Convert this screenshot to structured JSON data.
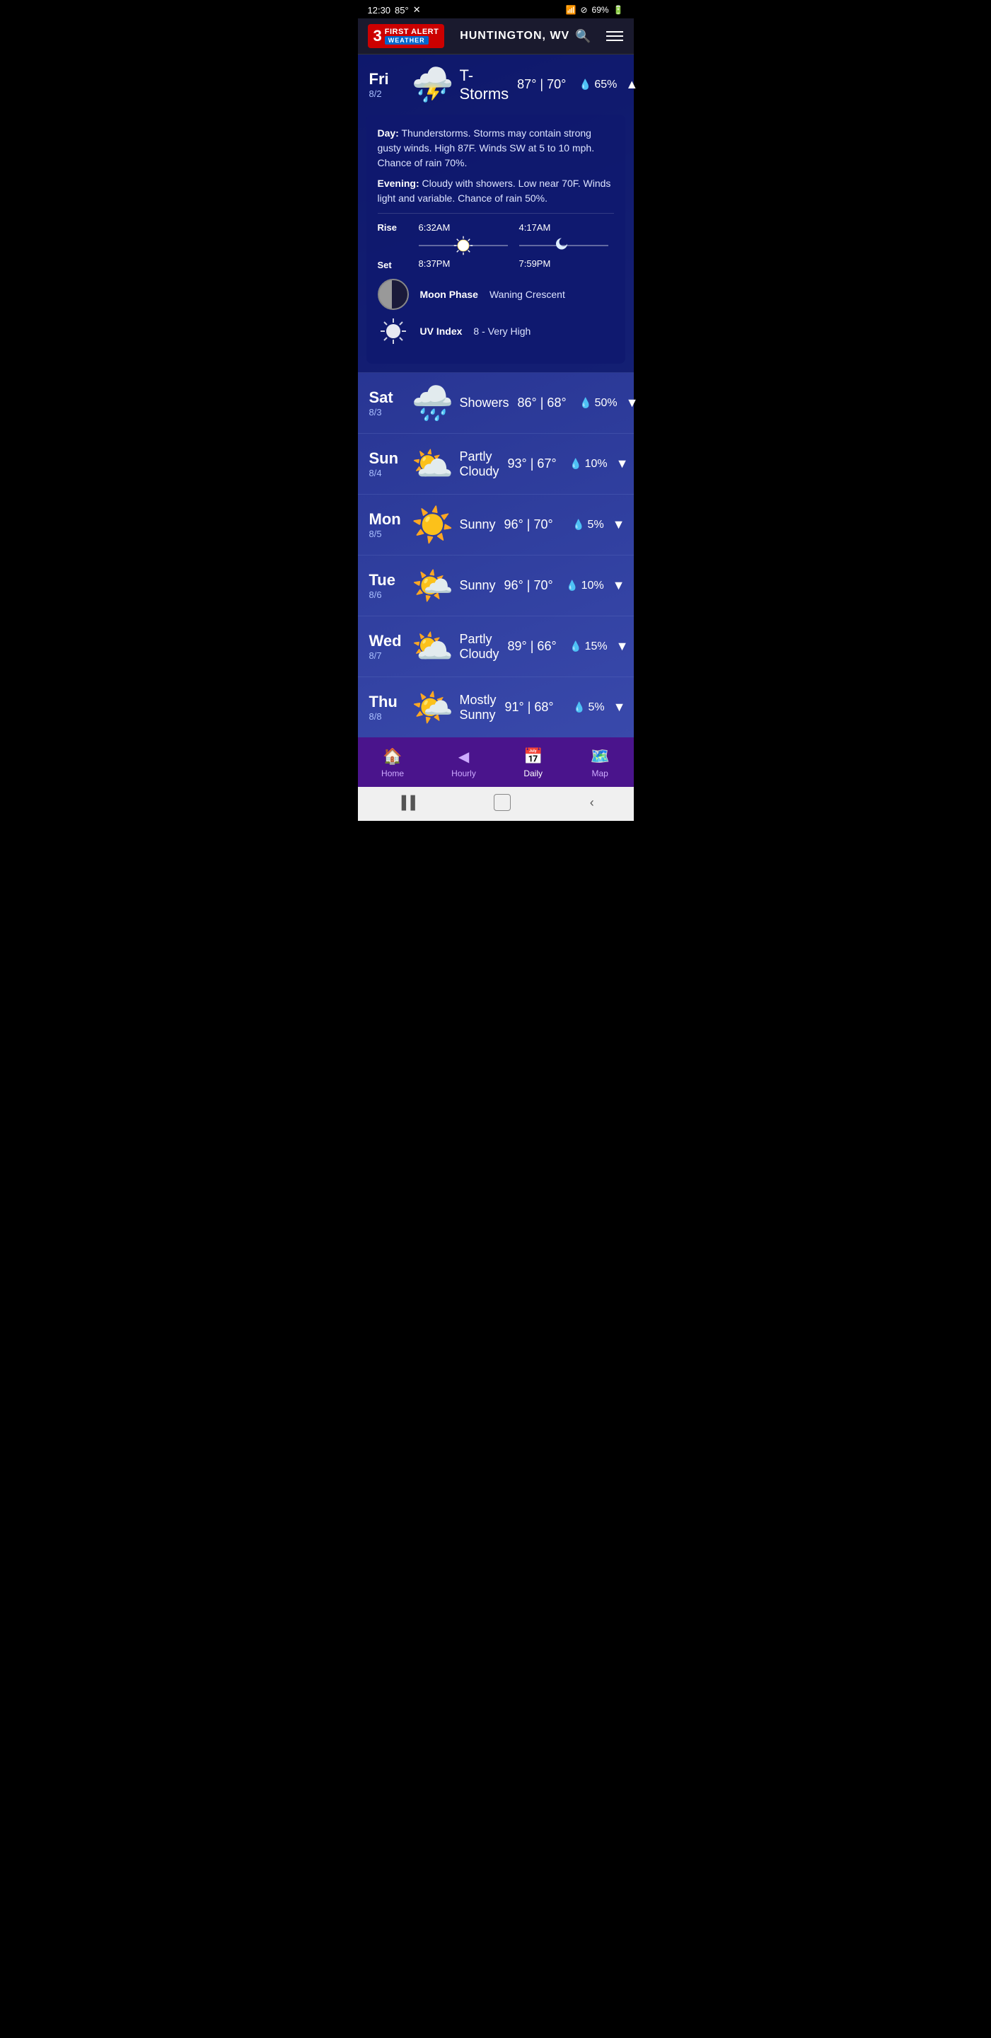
{
  "status_bar": {
    "time": "12:30",
    "temperature": "85°",
    "battery": "69%",
    "wifi": true
  },
  "header": {
    "logo_number": "3",
    "logo_first_alert": "FIRST ALERT",
    "logo_weather": "WEATHER",
    "location": "HUNTINGTON, WV",
    "search_placeholder": "Search location"
  },
  "expanded_day": {
    "day_name": "Fri",
    "day_date": "8/2",
    "condition": "T-Storms",
    "high": "87°",
    "low": "70°",
    "precip": "65%",
    "forecast_day": "Day:",
    "forecast_day_text": "Thunderstorms. Storms may contain strong gusty winds. High 87F. Winds SW at 5 to 10 mph. Chance of rain 70%.",
    "forecast_evening": "Evening:",
    "forecast_evening_text": "Cloudy with showers. Low near 70F. Winds light and variable. Chance of rain 50%.",
    "sun_rise_label": "Rise",
    "sun_set_label": "Set",
    "sun_rise_time": "6:32AM",
    "sun_set_time": "8:37PM",
    "moon_rise_time": "4:17AM",
    "moon_set_time": "7:59PM",
    "moon_phase_label": "Moon Phase",
    "moon_phase_value": "Waning Crescent",
    "uv_label": "UV Index",
    "uv_value": "8 - Very High"
  },
  "forecast_days": [
    {
      "day_name": "Sat",
      "day_date": "8/3",
      "condition": "Showers",
      "high": "86°",
      "low": "68°",
      "precip": "50%",
      "icon": "🌧️"
    },
    {
      "day_name": "Sun",
      "day_date": "8/4",
      "condition": "Partly\nCloudy",
      "high": "93°",
      "low": "67°",
      "precip": "10%",
      "icon": "⛅"
    },
    {
      "day_name": "Mon",
      "day_date": "8/5",
      "condition": "Sunny",
      "high": "96°",
      "low": "70°",
      "precip": "5%",
      "icon": "☀️"
    },
    {
      "day_name": "Tue",
      "day_date": "8/6",
      "condition": "Sunny",
      "high": "96°",
      "low": "70°",
      "precip": "10%",
      "icon": "🌤️"
    },
    {
      "day_name": "Wed",
      "day_date": "8/7",
      "condition": "Partly\nCloudy",
      "high": "89°",
      "low": "66°",
      "precip": "15%",
      "icon": "⛅"
    },
    {
      "day_name": "Thu",
      "day_date": "8/8",
      "condition": "Mostly\nSunny",
      "high": "91°",
      "low": "68°",
      "precip": "5%",
      "icon": "🌤️"
    }
  ],
  "bottom_nav": {
    "items": [
      {
        "label": "Home",
        "icon": "🏠",
        "active": false
      },
      {
        "label": "Hourly",
        "icon": "🕐",
        "active": false
      },
      {
        "label": "Daily",
        "icon": "📅",
        "active": true
      },
      {
        "label": "Map",
        "icon": "🗺️",
        "active": false
      }
    ]
  },
  "android_nav": {
    "back": "‹",
    "home": "○",
    "recents": "▐▐"
  }
}
